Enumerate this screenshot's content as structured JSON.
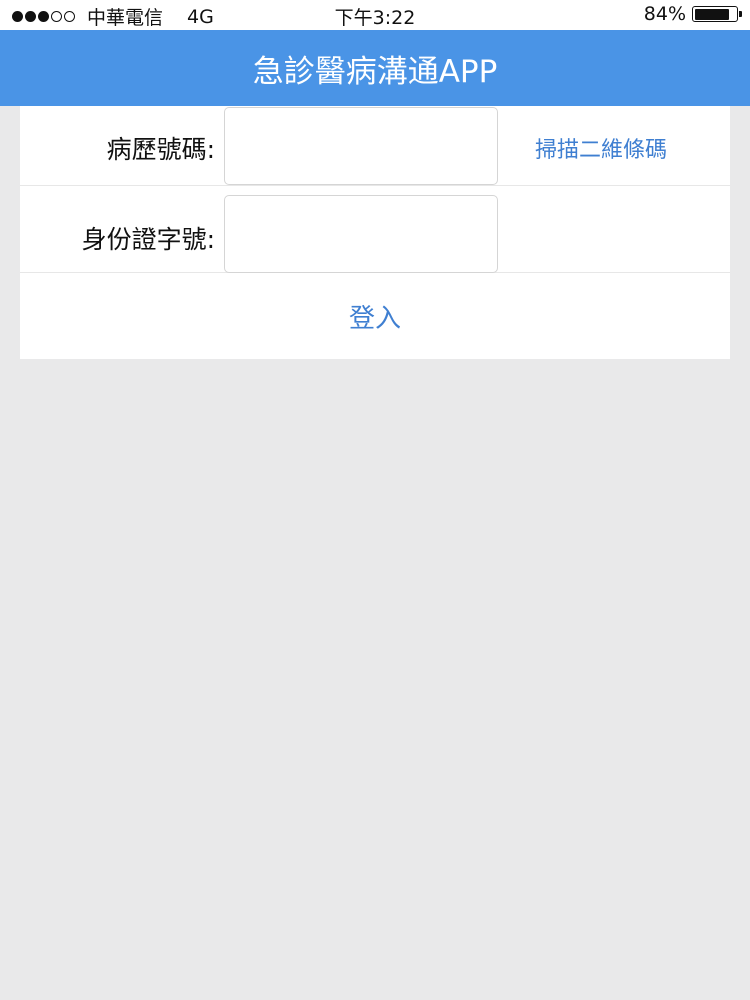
{
  "status_bar": {
    "carrier": "中華電信",
    "network": "4G",
    "time": "下午3:22",
    "battery_text": "84%",
    "battery_level": 0.84,
    "signal_strength": 3,
    "signal_max": 5
  },
  "nav": {
    "title": "急診醫病溝通APP"
  },
  "form": {
    "chart_number_label": "病歷號碼:",
    "chart_number_value": "",
    "scan_qr_label": "掃描二維條碼",
    "id_number_label": "身份證字號:",
    "id_number_value": "",
    "login_label": "登入"
  },
  "colors": {
    "nav_background": "#4a94e6",
    "accent": "#3f7fd1",
    "page_background": "#e9e9ea"
  }
}
